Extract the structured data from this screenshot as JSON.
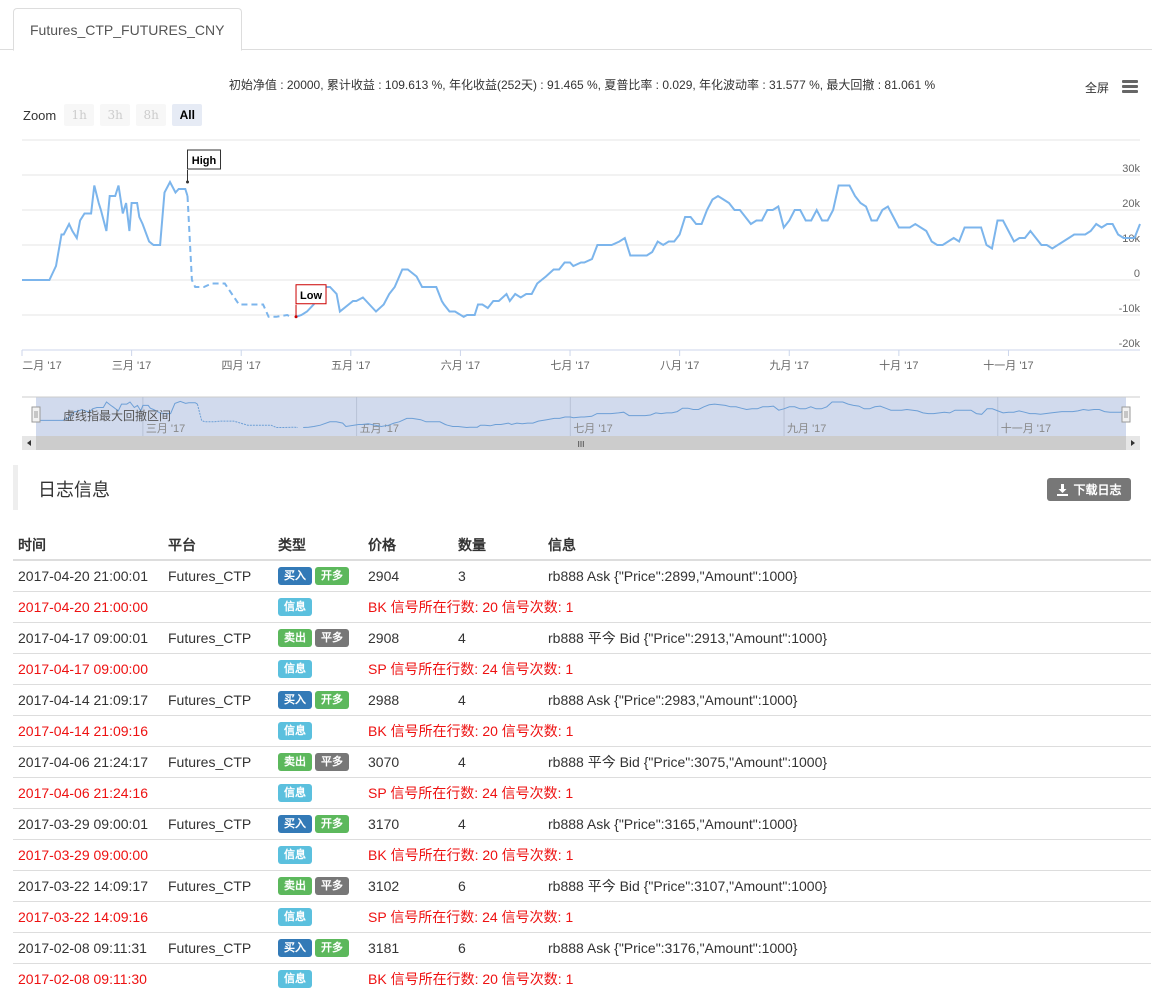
{
  "tab": {
    "label": "Futures_CTP_FUTURES_CNY"
  },
  "stats": {
    "text": "初始净值 : 20000, 累计收益 : 109.613 %, 年化收益(252天) : 91.465 %, 夏普比率 : 0.029, 年化波动率 : 31.577 %, 最大回撤 : 81.061 %"
  },
  "toolbar": {
    "fullscreen_label": "全屏",
    "menu_icon": "hamburger-menu-icon"
  },
  "zoom": {
    "label": "Zoom",
    "buttons": [
      "1h",
      "3h",
      "8h",
      "All"
    ],
    "active": "All"
  },
  "chart_data": {
    "type": "line",
    "title": "",
    "xlabel": "",
    "ylabel": "",
    "ylim": [
      -20000,
      30000
    ],
    "yticks": [
      30000,
      20000,
      10000,
      0,
      -10000,
      -20000
    ],
    "ytick_labels": [
      "30k",
      "20k",
      "10k",
      "0",
      "-10k",
      "-20k"
    ],
    "xtick_labels": [
      "二月 '17",
      "三月 '17",
      "四月 '17",
      "五月 '17",
      "六月 '17",
      "七月 '17",
      "八月 '17",
      "九月 '17",
      "十月 '17",
      "十一月 '17"
    ],
    "xticks_month_index": [
      0,
      1,
      2,
      3,
      4,
      5,
      6,
      7,
      8,
      9
    ],
    "x_range_months": [
      0,
      10.2
    ],
    "grid": true,
    "annotations": [
      {
        "label": "High",
        "x": 1.51,
        "y": 28000
      },
      {
        "label": "Low",
        "x": 2.5,
        "y": -10500
      }
    ],
    "drawdown_range_months": [
      1.55,
      2.48
    ],
    "series": [
      {
        "name": "equity",
        "x": [
          0,
          0.25,
          0.28,
          0.31,
          0.36,
          0.38,
          0.43,
          0.46,
          0.5,
          0.53,
          0.57,
          0.63,
          0.66,
          0.7,
          0.72,
          0.77,
          0.8,
          0.85,
          0.88,
          0.92,
          0.95,
          0.98,
          1.0,
          1.05,
          1.07,
          1.1,
          1.16,
          1.2,
          1.26,
          1.3,
          1.35,
          1.4,
          1.43,
          1.49,
          1.51,
          1.55,
          1.58,
          1.62,
          1.66,
          1.73,
          1.77,
          1.85,
          1.98,
          2.05,
          2.1,
          2.2,
          2.25,
          2.32,
          2.42,
          2.45,
          2.5,
          2.55,
          2.6,
          2.66,
          2.75,
          2.78,
          2.81,
          2.87,
          2.9,
          3.02,
          3.05,
          3.11,
          3.14,
          3.2,
          3.23,
          3.3,
          3.35,
          3.4,
          3.47,
          3.52,
          3.6,
          3.65,
          3.7,
          3.78,
          3.83,
          3.85,
          3.9,
          3.95,
          4.03,
          4.06,
          4.13,
          4.16,
          4.2,
          4.25,
          4.3,
          4.35,
          4.42,
          4.45,
          4.5,
          4.55,
          4.6,
          4.65,
          4.7,
          4.78,
          4.85,
          4.9,
          4.95,
          5.0,
          5.03,
          5.1,
          5.13,
          5.2,
          5.25,
          5.3,
          5.38,
          5.45,
          5.5,
          5.55,
          5.6,
          5.7,
          5.75,
          5.8,
          5.85,
          5.9,
          5.95,
          6.0,
          6.05,
          6.1,
          6.15,
          6.2,
          6.25,
          6.3,
          6.35,
          6.4,
          6.45,
          6.5,
          6.55,
          6.6,
          6.65,
          6.7,
          6.75,
          6.8,
          6.85,
          6.9,
          6.95,
          7.0,
          7.05,
          7.1,
          7.15,
          7.2,
          7.25,
          7.3,
          7.35,
          7.4,
          7.45,
          7.5,
          7.55,
          7.6,
          7.65,
          7.7,
          7.75,
          7.8,
          7.85,
          7.9,
          7.95,
          8.0,
          8.1,
          8.15,
          8.25,
          8.3,
          8.35,
          8.4,
          8.5,
          8.55,
          8.6,
          8.65,
          8.7,
          8.75,
          8.8,
          8.85,
          8.9,
          8.95,
          9.0,
          9.05,
          9.1,
          9.15,
          9.2,
          9.25,
          9.3,
          9.35,
          9.4,
          9.5,
          9.55,
          9.6,
          9.7,
          9.75,
          9.8,
          9.85,
          9.9,
          9.95,
          10.0,
          10.05,
          10.1,
          10.15,
          10.2
        ],
        "y": [
          0,
          0,
          2000,
          4000,
          13000,
          13000,
          16000,
          14000,
          12000,
          17000,
          19000,
          19000,
          27000,
          22000,
          20000,
          14000,
          24000,
          24000,
          27000,
          19000,
          22000,
          14000,
          22000,
          22000,
          18000,
          16000,
          11000,
          10000,
          10000,
          25000,
          28000,
          25000,
          26000,
          26000,
          24000,
          0,
          -2000,
          -2000,
          -2000,
          -1000,
          -1000,
          -1000,
          -7000,
          -7000,
          -7000,
          -7000,
          -10500,
          -10500,
          -10000,
          -10500,
          -10500,
          -10000,
          -9000,
          -7000,
          -2000,
          -2000,
          -2000,
          -4000,
          -9000,
          -6000,
          -6000,
          -5000,
          -6000,
          -8000,
          -9000,
          -7000,
          -4000,
          -2000,
          3000,
          3000,
          1000,
          -2000,
          -2000,
          -2000,
          -6000,
          -7000,
          -9000,
          -9000,
          -10500,
          -10000,
          -10000,
          -7000,
          -7000,
          -8000,
          -6000,
          -6000,
          -4000,
          -6000,
          -4000,
          -5000,
          -4000,
          -4000,
          -1000,
          1000,
          3000,
          3000,
          5000,
          5000,
          4000,
          5000,
          5000,
          6000,
          10000,
          10000,
          10000,
          11000,
          12000,
          7000,
          7000,
          7000,
          8000,
          11000,
          10000,
          11000,
          11000,
          13000,
          18000,
          18000,
          16000,
          16000,
          20000,
          23000,
          24000,
          23000,
          22000,
          20000,
          20000,
          18000,
          16000,
          17000,
          17000,
          20000,
          20000,
          21000,
          15000,
          17000,
          20000,
          20000,
          17000,
          17000,
          20000,
          17000,
          17000,
          20000,
          27000,
          27000,
          27000,
          24000,
          22000,
          21000,
          17000,
          17000,
          20000,
          21000,
          18000,
          15000,
          15000,
          16000,
          14000,
          11000,
          10000,
          10000,
          12000,
          11000,
          15000,
          15000,
          15000,
          15000,
          10000,
          9000,
          17000,
          17000,
          14000,
          11000,
          12000,
          12000,
          14000,
          12000,
          10000,
          10000,
          9000,
          11000,
          12000,
          13000,
          13000,
          14000,
          16000,
          15000,
          16000,
          16000,
          13000,
          12000,
          12000,
          12000,
          16000,
          17000,
          17000,
          17000,
          18000,
          19500
        ]
      }
    ]
  },
  "navigator": {
    "label": "虚线指最大回撤区间",
    "xtick_labels": [
      "三月 '17",
      "五月 '17",
      "七月 '17",
      "九月 '17",
      "十一月 '17"
    ],
    "xticks_month_index": [
      1,
      3,
      5,
      7,
      9
    ],
    "scroll_handle_glyph": "III"
  },
  "log": {
    "title": "日志信息",
    "download_label": "下载日志",
    "columns": [
      "时间",
      "平台",
      "类型",
      "价格",
      "数量",
      "信息"
    ],
    "rows": [
      {
        "kind": "trade",
        "time": "2017-04-20 21:00:01",
        "platform": "Futures_CTP",
        "badges": [
          {
            "label": "买入",
            "cls": "b-buy"
          },
          {
            "label": "开多",
            "cls": "b-open"
          }
        ],
        "price": "2904",
        "amount": "3",
        "info": "rb888 Ask {\"Price\":2899,\"Amount\":1000}"
      },
      {
        "kind": "info",
        "time": "2017-04-20 21:00:00",
        "platform": "",
        "badges": [
          {
            "label": "信息",
            "cls": "b-info"
          }
        ],
        "price": "",
        "amount": "",
        "info": "BK 信号所在行数: 20 信号次数: 1"
      },
      {
        "kind": "trade",
        "time": "2017-04-17 09:00:01",
        "platform": "Futures_CTP",
        "badges": [
          {
            "label": "卖出",
            "cls": "b-sell"
          },
          {
            "label": "平多",
            "cls": "b-close"
          }
        ],
        "price": "2908",
        "amount": "4",
        "info": "rb888 平今 Bid {\"Price\":2913,\"Amount\":1000}"
      },
      {
        "kind": "info",
        "time": "2017-04-17 09:00:00",
        "platform": "",
        "badges": [
          {
            "label": "信息",
            "cls": "b-info"
          }
        ],
        "price": "",
        "amount": "",
        "info": "SP 信号所在行数: 24 信号次数: 1"
      },
      {
        "kind": "trade",
        "time": "2017-04-14 21:09:17",
        "platform": "Futures_CTP",
        "badges": [
          {
            "label": "买入",
            "cls": "b-buy"
          },
          {
            "label": "开多",
            "cls": "b-open"
          }
        ],
        "price": "2988",
        "amount": "4",
        "info": "rb888 Ask {\"Price\":2983,\"Amount\":1000}"
      },
      {
        "kind": "info",
        "time": "2017-04-14 21:09:16",
        "platform": "",
        "badges": [
          {
            "label": "信息",
            "cls": "b-info"
          }
        ],
        "price": "",
        "amount": "",
        "info": "BK 信号所在行数: 20 信号次数: 1"
      },
      {
        "kind": "trade",
        "time": "2017-04-06 21:24:17",
        "platform": "Futures_CTP",
        "badges": [
          {
            "label": "卖出",
            "cls": "b-sell"
          },
          {
            "label": "平多",
            "cls": "b-close"
          }
        ],
        "price": "3070",
        "amount": "4",
        "info": "rb888 平今 Bid {\"Price\":3075,\"Amount\":1000}"
      },
      {
        "kind": "info",
        "time": "2017-04-06 21:24:16",
        "platform": "",
        "badges": [
          {
            "label": "信息",
            "cls": "b-info"
          }
        ],
        "price": "",
        "amount": "",
        "info": "SP 信号所在行数: 24 信号次数: 1"
      },
      {
        "kind": "trade",
        "time": "2017-03-29 09:00:01",
        "platform": "Futures_CTP",
        "badges": [
          {
            "label": "买入",
            "cls": "b-buy"
          },
          {
            "label": "开多",
            "cls": "b-open"
          }
        ],
        "price": "3170",
        "amount": "4",
        "info": "rb888 Ask {\"Price\":3165,\"Amount\":1000}"
      },
      {
        "kind": "info",
        "time": "2017-03-29 09:00:00",
        "platform": "",
        "badges": [
          {
            "label": "信息",
            "cls": "b-info"
          }
        ],
        "price": "",
        "amount": "",
        "info": "BK 信号所在行数: 20 信号次数: 1"
      },
      {
        "kind": "trade",
        "time": "2017-03-22 14:09:17",
        "platform": "Futures_CTP",
        "badges": [
          {
            "label": "卖出",
            "cls": "b-sell"
          },
          {
            "label": "平多",
            "cls": "b-close"
          }
        ],
        "price": "3102",
        "amount": "6",
        "info": "rb888 平今 Bid {\"Price\":3107,\"Amount\":1000}"
      },
      {
        "kind": "info",
        "time": "2017-03-22 14:09:16",
        "platform": "",
        "badges": [
          {
            "label": "信息",
            "cls": "b-info"
          }
        ],
        "price": "",
        "amount": "",
        "info": "SP 信号所在行数: 24 信号次数: 1"
      },
      {
        "kind": "trade",
        "time": "2017-02-08 09:11:31",
        "platform": "Futures_CTP",
        "badges": [
          {
            "label": "买入",
            "cls": "b-buy"
          },
          {
            "label": "开多",
            "cls": "b-open"
          }
        ],
        "price": "3181",
        "amount": "6",
        "info": "rb888 Ask {\"Price\":3176,\"Amount\":1000}"
      },
      {
        "kind": "info",
        "time": "2017-02-08 09:11:30",
        "platform": "",
        "badges": [
          {
            "label": "信息",
            "cls": "b-info"
          }
        ],
        "price": "",
        "amount": "",
        "info": "BK 信号所在行数: 20 信号次数: 1"
      }
    ]
  },
  "colors": {
    "line": "#7cb5ec",
    "negative_text": "#e11111",
    "navigator_mask": "#ccd6eb"
  }
}
